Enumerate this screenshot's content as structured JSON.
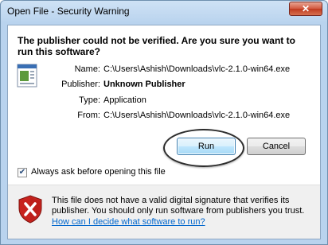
{
  "window": {
    "title": "Open File - Security Warning",
    "close_glyph": "✕"
  },
  "headline": "The publisher could not be verified.  Are you sure you want to run this software?",
  "details": [
    {
      "label": "Name:",
      "value": "C:\\Users\\Ashish\\Downloads\\vlc-2.1.0-win64.exe",
      "bold": false
    },
    {
      "label": "Publisher:",
      "value": "Unknown Publisher",
      "bold": true
    },
    {
      "label": "Type:",
      "value": "Application",
      "bold": false
    },
    {
      "label": "From:",
      "value": "C:\\Users\\Ashish\\Downloads\\vlc-2.1.0-win64.exe",
      "bold": false
    }
  ],
  "buttons": {
    "run": "Run",
    "cancel": "Cancel"
  },
  "checkbox": {
    "label": "Always ask before opening this file",
    "checked": true,
    "check_glyph": "✔"
  },
  "warning": {
    "text": "This file does not have a valid digital signature that verifies its publisher.  You should only run software from publishers you trust.",
    "link": "How can I decide what software to run?"
  },
  "colors": {
    "accent": "#0066cc",
    "shield_red": "#c8231e"
  }
}
